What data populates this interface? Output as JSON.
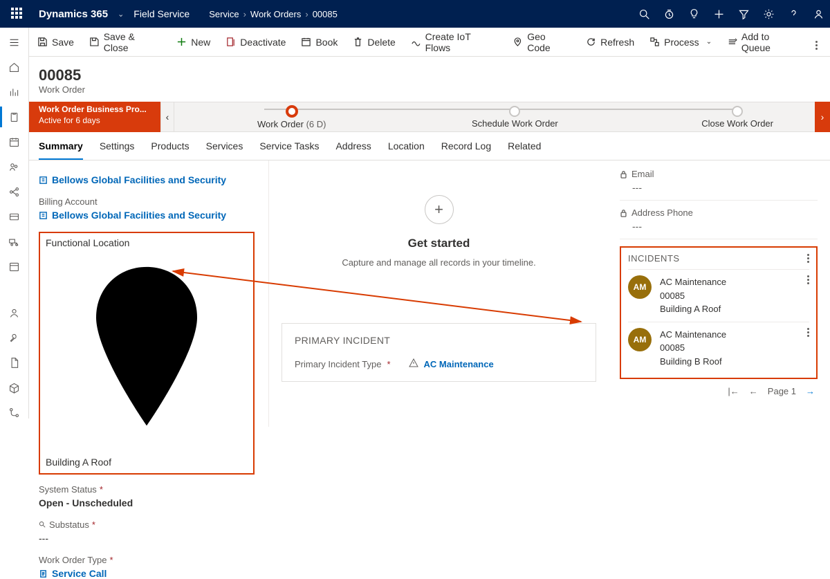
{
  "topnav": {
    "brand": "Dynamics 365",
    "service": "Field Service",
    "breadcrumb": [
      "Service",
      "Work Orders",
      "00085"
    ]
  },
  "commands": {
    "save": "Save",
    "saveclose": "Save & Close",
    "new": "New",
    "deactivate": "Deactivate",
    "book": "Book",
    "delete": "Delete",
    "iot": "Create IoT Flows",
    "geo": "Geo Code",
    "refresh": "Refresh",
    "process": "Process",
    "queue": "Add to Queue"
  },
  "record": {
    "title": "00085",
    "entity": "Work Order"
  },
  "bpf": {
    "name": "Work Order Business Pro...",
    "duration": "Active for 6 days",
    "stages": [
      {
        "label": "Work Order",
        "meta": "(6 D)",
        "active": true
      },
      {
        "label": "Schedule Work Order",
        "meta": "",
        "active": false
      },
      {
        "label": "Close Work Order",
        "meta": "",
        "active": false
      }
    ]
  },
  "tabs": [
    "Summary",
    "Settings",
    "Products",
    "Services",
    "Service Tasks",
    "Address",
    "Location",
    "Record Log",
    "Related"
  ],
  "summary": {
    "serviceAccount": {
      "value": "Bellows Global Facilities and Security"
    },
    "billingAccountLabel": "Billing Account",
    "billingAccount": {
      "value": "Bellows Global Facilities and Security"
    },
    "functionalLocationLabel": "Functional Location",
    "functionalLocation": "Building A Roof",
    "systemStatusLabel": "System Status",
    "systemStatusValue": "Open - Unscheduled",
    "substatusLabel": "Substatus",
    "substatusValue": "---",
    "workOrderTypeLabel": "Work Order Type",
    "workOrderTypeValue": "Service Call"
  },
  "timeline": {
    "heading": "Get started",
    "desc": "Capture and manage all records in your timeline."
  },
  "primaryIncident": {
    "heading": "PRIMARY INCIDENT",
    "typeLabel": "Primary Incident Type",
    "typeValue": "AC Maintenance"
  },
  "rightPane": {
    "emailLabel": "Email",
    "emailValue": "---",
    "addressPhoneLabel": "Address Phone",
    "addressPhoneValue": "---",
    "incidentsHeading": "INCIDENTS",
    "incidents": [
      {
        "initials": "AM",
        "title": "AC Maintenance",
        "wo": "00085",
        "loc": "Building A Roof"
      },
      {
        "initials": "AM",
        "title": "AC Maintenance",
        "wo": "00085",
        "loc": "Building B Roof"
      }
    ],
    "pageLabel": "Page 1"
  }
}
